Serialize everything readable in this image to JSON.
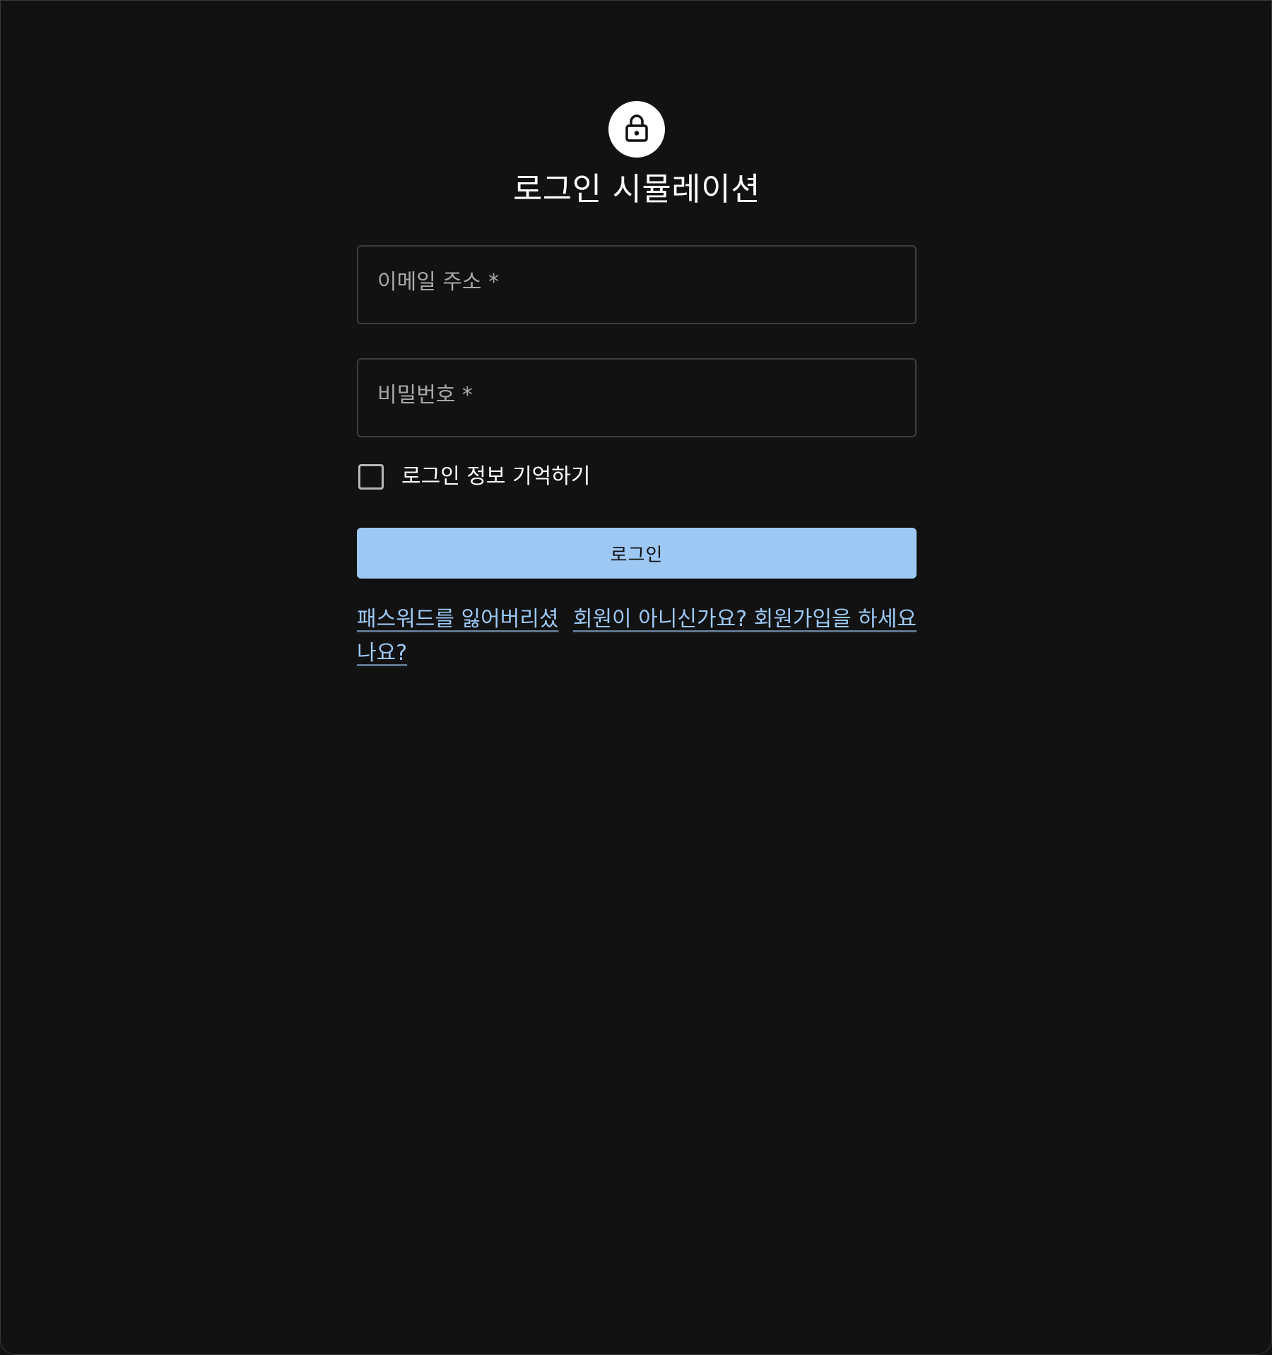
{
  "app": {
    "title": "로그인 시뮬레이션"
  },
  "icons": {
    "avatar_icon": "lock-icon"
  },
  "form": {
    "email_label": "이메일 주소 *",
    "password_label": "비밀번호 *",
    "remember_label": "로그인 정보 기억하기",
    "remember_checked": false,
    "submit_label": "로그인"
  },
  "links": {
    "forgot_password": "패스워드를 잃어버리셨나요?",
    "signup": "회원이 아니신가요? 회원가입을 하세요"
  },
  "colors": {
    "background": "#121212",
    "accent": "#9dc8f4",
    "text": "#ffffff",
    "muted_text": "#a8a8a8",
    "border": "#3d3d3d"
  }
}
